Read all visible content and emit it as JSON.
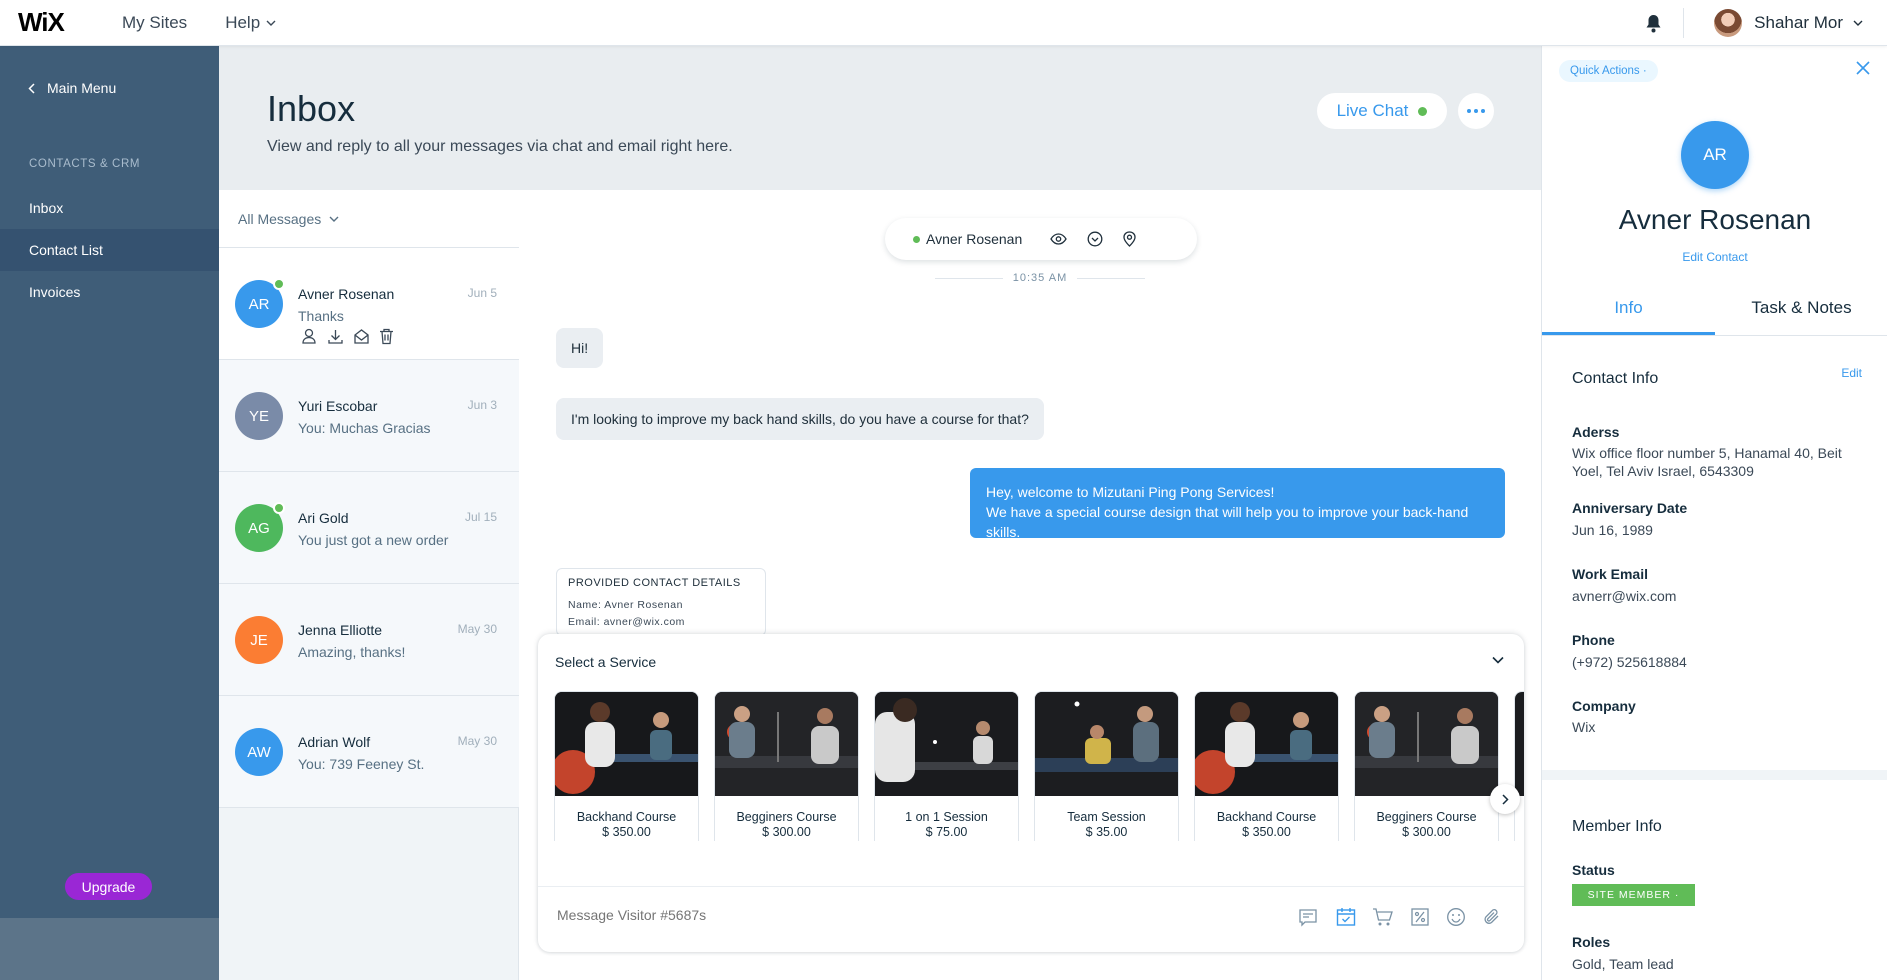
{
  "topbar": {
    "logo": "WiX",
    "my_sites": "My Sites",
    "help": "Help",
    "user_name": "Shahar Mor"
  },
  "sidebar": {
    "main_menu": "Main Menu",
    "section": "CONTACTS & CRM",
    "items": [
      {
        "label": "Inbox"
      },
      {
        "label": "Contact List"
      },
      {
        "label": "Invoices"
      }
    ],
    "upgrade": "Upgrade"
  },
  "header": {
    "title": "Inbox",
    "subtitle": "View and reply to all your messages via chat and email right here.",
    "live_chat": "Live Chat"
  },
  "conversations": {
    "filter": "All Messages",
    "items": [
      {
        "initials": "AR",
        "name": "Avner Rosenan",
        "message": "Thanks",
        "date": "Jun 5",
        "color": "#3899ec",
        "online": true
      },
      {
        "initials": "YE",
        "name": "Yuri Escobar",
        "message": "You: Muchas Gracias",
        "date": "Jun 3",
        "color": "#7a8ba8",
        "online": false
      },
      {
        "initials": "AG",
        "name": "Ari Gold",
        "message": "You just got a new order",
        "date": "Jul 15",
        "color": "#4eb85d",
        "online": true
      },
      {
        "initials": "JE",
        "name": "Jenna Elliotte",
        "message": "Amazing, thanks!",
        "date": "May 30",
        "color": "#fb7d33",
        "online": false
      },
      {
        "initials": "AW",
        "name": "Adrian Wolf",
        "message": "You: 739 Feeney St.",
        "date": "May 30",
        "color": "#3899ec",
        "online": false
      }
    ]
  },
  "chat": {
    "visitor": "Avner Rosenan",
    "time": "10:35 AM",
    "messages": {
      "in1": "Hi!",
      "in2": "I'm looking to improve my back hand skills, do you have a course for that?",
      "out1_line1": "Hey, welcome to Mizutani Ping Pong Services!",
      "out1_line2": "We have a special course design that will help you to improve your back-hand skills."
    },
    "details": {
      "title": "PROVIDED CONTACT DETAILS",
      "name": "Name: Avner Rosenan",
      "email": "Email: avner@wix.com"
    },
    "service_panel": {
      "title": "Select a Service",
      "services": [
        {
          "name": "Backhand Course",
          "price": "$ 350.00",
          "type": "COURSE"
        },
        {
          "name": "Begginers Course",
          "price": "$ 300.00",
          "type": "COURSE"
        },
        {
          "name": "1 on 1 Session",
          "price": "$ 75.00",
          "type": "SERVICE"
        },
        {
          "name": "Team Session",
          "price": "$ 35.00",
          "type": "SERVICE"
        },
        {
          "name": "Backhand Course",
          "price": "$ 350.00",
          "type": "COURSE"
        },
        {
          "name": "Begginers Course",
          "price": "$ 300.00",
          "type": "COURSE"
        }
      ]
    },
    "composer_placeholder": "Message Visitor #5687s"
  },
  "contact": {
    "quick_actions": "Quick Actions ·",
    "initials": "AR",
    "name": "Avner Rosenan",
    "edit_contact": "Edit Contact",
    "tabs": [
      "Info",
      "Task & Notes"
    ],
    "contact_info_title": "Contact Info",
    "edit": "Edit",
    "fields": [
      {
        "label": "Aderss",
        "value": "Wix office floor number 5, Hanamal 40, Beit Yoel, Tel Aviv Israel, 6543309"
      },
      {
        "label": "Anniversary Date",
        "value": "Jun 16, 1989"
      },
      {
        "label": "Work Email",
        "value": "avnerr@wix.com"
      },
      {
        "label": "Phone",
        "value": "(+972) 525618884"
      },
      {
        "label": "Company",
        "value": "Wix"
      }
    ],
    "member_info_title": "Member Info",
    "status_label": "Status",
    "status_badge": "SITE MEMBER ·",
    "roles_label": "Roles",
    "roles_value": "Gold, Team lead"
  },
  "colors": {
    "accent": "#3899ec",
    "sidebar": "#3f5d78",
    "online": "#60bc57",
    "upgrade": "#9a27d5"
  }
}
